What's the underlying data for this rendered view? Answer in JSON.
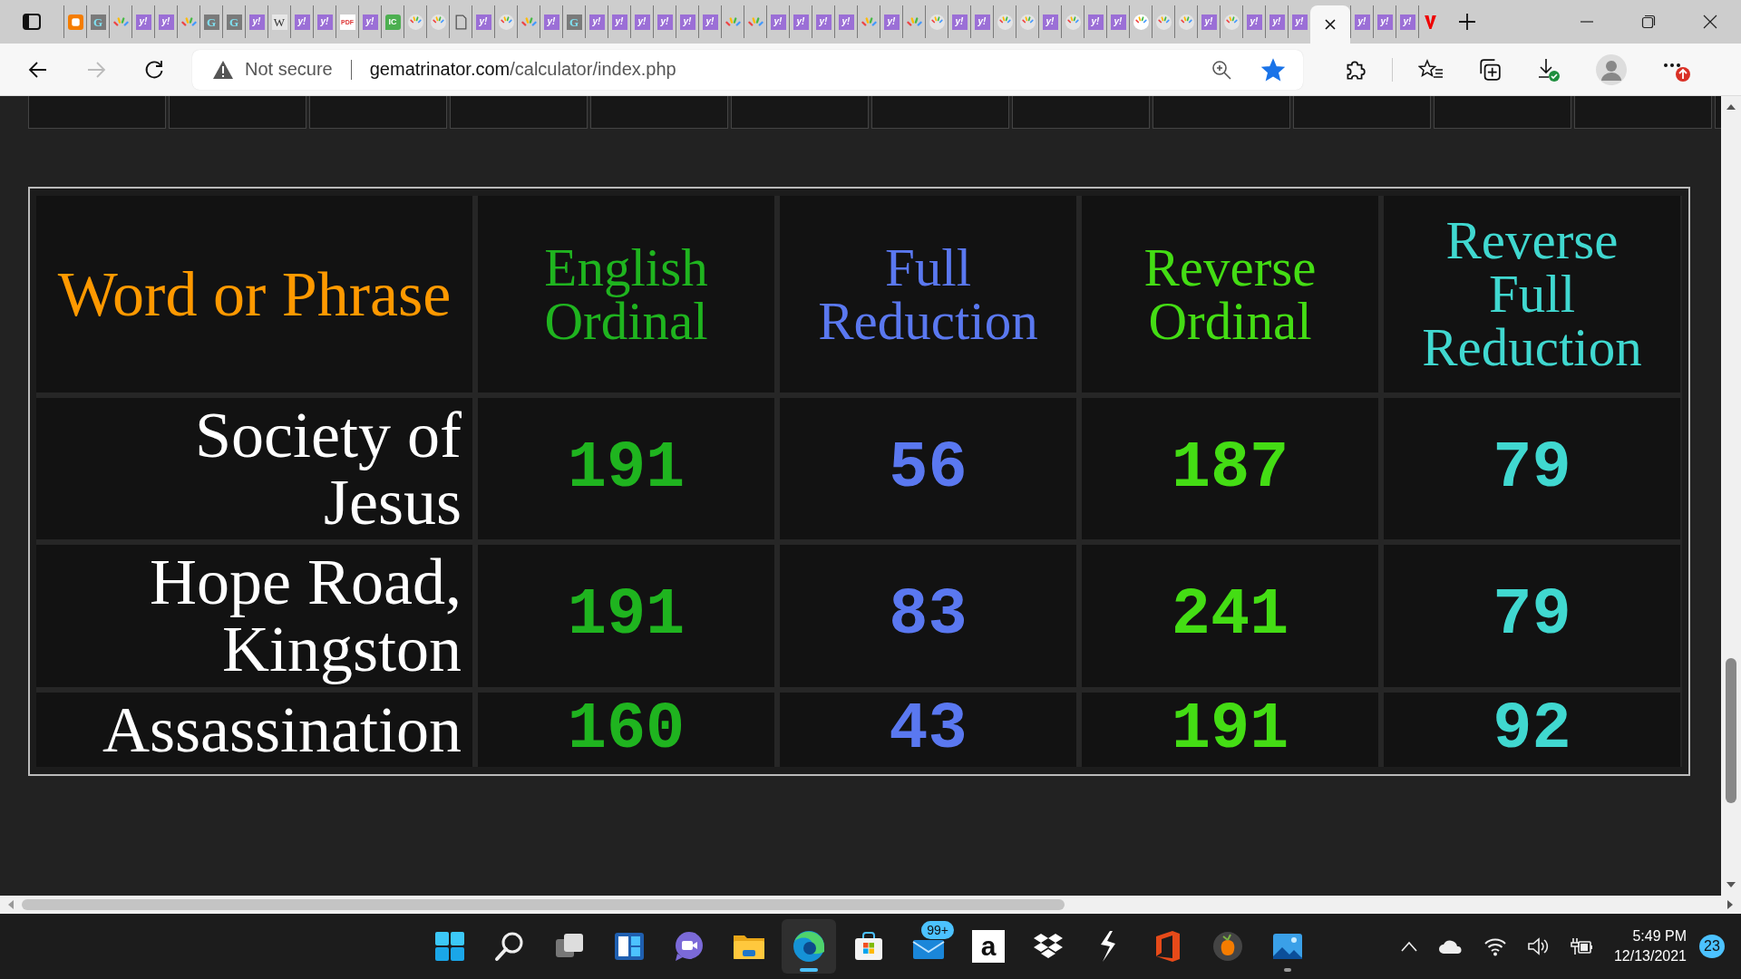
{
  "browser": {
    "tabs": [
      {
        "kind": "blogger",
        "selected": false
      },
      {
        "kind": "gem",
        "label": "G",
        "selected": false
      },
      {
        "kind": "pinwheel",
        "selected": false
      },
      {
        "kind": "yahoo",
        "label": "y!",
        "selected": false
      },
      {
        "kind": "yahoo",
        "label": "y!",
        "selected": false
      },
      {
        "kind": "pinwheel",
        "selected": false
      },
      {
        "kind": "gem",
        "label": "G",
        "selected": false
      },
      {
        "kind": "gem",
        "label": "G",
        "selected": false
      },
      {
        "kind": "yahoo",
        "label": "y!",
        "selected": false
      },
      {
        "kind": "wiki",
        "label": "W",
        "selected": false
      },
      {
        "kind": "yahoo",
        "label": "y!",
        "selected": false
      },
      {
        "kind": "yahoo",
        "label": "y!",
        "selected": false
      },
      {
        "kind": "pdf",
        "label": "PDF",
        "selected": false
      },
      {
        "kind": "yahoo",
        "label": "y!",
        "selected": false
      },
      {
        "kind": "ic",
        "label": "IC",
        "selected": false
      },
      {
        "kind": "pinwheel-round",
        "selected": false
      },
      {
        "kind": "pinwheel-round",
        "selected": false
      },
      {
        "kind": "doc",
        "selected": false
      },
      {
        "kind": "yahoo",
        "label": "y!",
        "selected": false
      },
      {
        "kind": "pinwheel-round",
        "selected": false
      },
      {
        "kind": "pinwheel",
        "selected": false
      },
      {
        "kind": "yahoo",
        "label": "y!",
        "selected": false
      },
      {
        "kind": "gem",
        "label": "G",
        "selected": false
      },
      {
        "kind": "yahoo",
        "label": "y!",
        "selected": false
      },
      {
        "kind": "yahoo",
        "label": "y!",
        "selected": false
      },
      {
        "kind": "yahoo",
        "label": "y!",
        "selected": false
      },
      {
        "kind": "yahoo",
        "label": "y!",
        "selected": false
      },
      {
        "kind": "yahoo",
        "label": "y!",
        "selected": false
      },
      {
        "kind": "yahoo",
        "label": "y!",
        "selected": false
      },
      {
        "kind": "pinwheel",
        "selected": false
      },
      {
        "kind": "pinwheel",
        "selected": false
      },
      {
        "kind": "yahoo",
        "label": "y!",
        "selected": false
      },
      {
        "kind": "yahoo",
        "label": "y!",
        "selected": false
      },
      {
        "kind": "yahoo",
        "label": "y!",
        "selected": false
      },
      {
        "kind": "yahoo",
        "label": "y!",
        "selected": false
      },
      {
        "kind": "pinwheel",
        "selected": false
      },
      {
        "kind": "yahoo",
        "label": "y!",
        "selected": false
      },
      {
        "kind": "pinwheel",
        "selected": false
      },
      {
        "kind": "pinwheel-round",
        "selected": false
      },
      {
        "kind": "yahoo",
        "label": "y!",
        "selected": false
      },
      {
        "kind": "yahoo",
        "label": "y!",
        "selected": false
      },
      {
        "kind": "pinwheel-round",
        "selected": false
      },
      {
        "kind": "pinwheel-round",
        "selected": false
      },
      {
        "kind": "yahoo",
        "label": "y!",
        "selected": false
      },
      {
        "kind": "pinwheel-round",
        "selected": false
      },
      {
        "kind": "yahoo",
        "label": "y!",
        "selected": false
      },
      {
        "kind": "yahoo",
        "label": "y!",
        "selected": false
      },
      {
        "kind": "pinwheel-bright",
        "selected": false
      },
      {
        "kind": "pinwheel-round",
        "selected": false
      },
      {
        "kind": "pinwheel-round",
        "selected": false
      },
      {
        "kind": "yahoo",
        "label": "y!",
        "selected": false
      },
      {
        "kind": "pinwheel-round",
        "selected": false
      },
      {
        "kind": "yahoo",
        "label": "y!",
        "selected": false
      },
      {
        "kind": "yahoo",
        "label": "y!",
        "selected": false
      },
      {
        "kind": "yahoo",
        "label": "y!",
        "selected": false
      },
      {
        "kind": "page",
        "selected": true
      },
      {
        "kind": "yahoo",
        "label": "y!",
        "selected": false
      },
      {
        "kind": "yahoo",
        "label": "y!",
        "selected": false
      },
      {
        "kind": "yahoo",
        "label": "y!",
        "selected": false
      },
      {
        "kind": "vlogo",
        "selected": false
      }
    ],
    "address_bar": {
      "security": "Not secure",
      "url_domain": "gematrinator.com",
      "url_path": "/calculator/index.php",
      "favorited": true
    }
  },
  "table": {
    "columns": [
      {
        "label": "Word or Phrase",
        "color": "#ff9900"
      },
      {
        "label": "English Ordinal",
        "color": "#1fb41f"
      },
      {
        "label": "Full Reduction",
        "color": "#5a78f0"
      },
      {
        "label": "Reverse Ordinal",
        "color": "#44dd14"
      },
      {
        "label": "Reverse Full Reduction",
        "color": "#40d8d0"
      }
    ],
    "rows": [
      {
        "phrase": "Society of Jesus",
        "values": [
          "191",
          "56",
          "187",
          "79"
        ]
      },
      {
        "phrase": "Hope Road, Kingston",
        "values": [
          "191",
          "83",
          "241",
          "79"
        ]
      },
      {
        "phrase": "Assassination",
        "values": [
          "160",
          "43",
          "191",
          "92"
        ]
      }
    ]
  },
  "taskbar": {
    "apps": [
      {
        "kind": "start",
        "selected": false,
        "running": false
      },
      {
        "kind": "search",
        "selected": false,
        "running": false
      },
      {
        "kind": "taskview",
        "selected": false,
        "running": false
      },
      {
        "kind": "widgets",
        "selected": false,
        "running": false
      },
      {
        "kind": "chat",
        "selected": false,
        "running": false
      },
      {
        "kind": "explorer",
        "selected": false,
        "running": false
      },
      {
        "kind": "edge",
        "selected": true,
        "running": true
      },
      {
        "kind": "store",
        "selected": false,
        "running": false
      },
      {
        "kind": "mail",
        "badge": "99+",
        "selected": false,
        "running": false
      },
      {
        "kind": "amazon",
        "label": "a",
        "selected": false,
        "running": false
      },
      {
        "kind": "dropbox",
        "selected": false,
        "running": false
      },
      {
        "kind": "bolt",
        "selected": false,
        "running": false
      },
      {
        "kind": "office",
        "selected": false,
        "running": false
      },
      {
        "kind": "fruit",
        "selected": false,
        "running": false
      },
      {
        "kind": "photos",
        "selected": false,
        "running": true
      }
    ],
    "tray": {
      "time": "5:49 PM",
      "date": "12/13/2021",
      "notifications": "23"
    }
  }
}
